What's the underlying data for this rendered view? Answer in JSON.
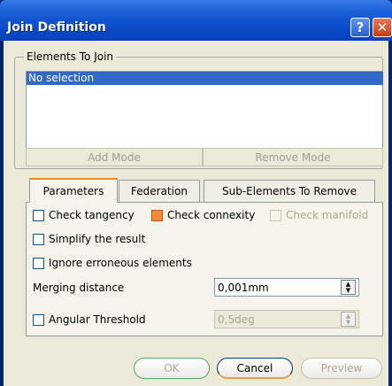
{
  "window": {
    "title": "Join Definition",
    "help_glyph": "?",
    "close_glyph": "✕"
  },
  "elements_group": {
    "legend": "Elements To Join",
    "items": [
      "No selection"
    ],
    "add_mode_label": "Add Mode",
    "remove_mode_label": "Remove Mode"
  },
  "tabs": [
    {
      "label": "Parameters",
      "active": true
    },
    {
      "label": "Federation",
      "active": false
    },
    {
      "label": "Sub-Elements To Remove",
      "active": false
    }
  ],
  "parameters": {
    "check_tangency_label": "Check tangency",
    "check_connexity_label": "Check connexity",
    "check_manifold_label": "Check manifold",
    "simplify_label": "Simplify the result",
    "ignore_label": "Ignore erroneous elements",
    "merging_distance_label": "Merging distance",
    "merging_distance_value": "0,001mm",
    "angular_threshold_label": "Angular Threshold",
    "angular_threshold_value": "0,5deg"
  },
  "footer": {
    "ok_label": "OK",
    "cancel_label": "Cancel",
    "preview_label": "Preview"
  },
  "colors": {
    "title_bar": "#0a4ac8",
    "selection": "#316ac5",
    "connexity_check": "#f08a3c"
  }
}
